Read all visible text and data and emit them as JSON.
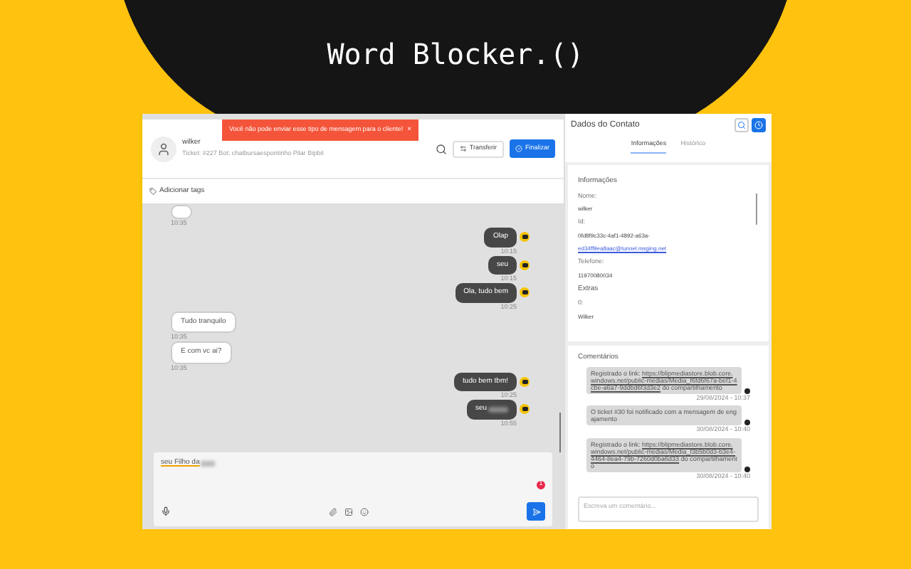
{
  "banner": {
    "title": "Word Blocker.()"
  },
  "toast": {
    "message": "Você não pode enviar esse tipo de mensagem para o cliente!",
    "close": "×"
  },
  "contact_header": {
    "name": "wilker",
    "subtitle": "Ticket: #227 Bot: chatbursaespontinho Pilar Bipbit",
    "transfer": "Transferir",
    "finish": "Finalizar"
  },
  "tags": {
    "label": "Adicionar tags"
  },
  "messages": [
    {
      "kind": "in",
      "time": "10:35",
      "blurred": false
    },
    {
      "kind": "out",
      "text": "Olap",
      "time": "10:15",
      "blurred": false
    },
    {
      "kind": "out",
      "text": "seu",
      "time": "10:15",
      "blurred": false
    },
    {
      "kind": "out",
      "text": "Ola, tudo bem",
      "time": "10:25",
      "blurred": false
    },
    {
      "kind": "in",
      "text": "Tudo tranquilo",
      "time": "10:35",
      "blurred": false
    },
    {
      "kind": "in",
      "text": "E com vc ai?",
      "time": "10:35",
      "blurred": false
    },
    {
      "kind": "out",
      "text": "tudo bem tbm!",
      "time": "10:25",
      "blurred": false
    },
    {
      "kind": "out",
      "text": "seu",
      "time": "10:55",
      "blurred": true
    }
  ],
  "composer": {
    "value": "seu Filho da",
    "blurred_tail": true,
    "badge": "1"
  },
  "contact_panel": {
    "title": "Dados do Contato",
    "tabs": [
      {
        "label": "Informações",
        "selected": true
      },
      {
        "label": "Histórico",
        "selected": false
      }
    ],
    "info": {
      "heading": "Informações",
      "fields": [
        {
          "kind": "label",
          "text": "Nome:"
        },
        {
          "kind": "value",
          "text": "wilker"
        },
        {
          "kind": "label",
          "text": "Id:"
        },
        {
          "kind": "value",
          "text": "0fd8f9c33c-4af1-4892-a63a-"
        },
        {
          "kind": "link",
          "text": "ed34ff9ea8aac@tunnel.msging.net"
        },
        {
          "kind": "label",
          "text": "Telefone:"
        },
        {
          "kind": "value",
          "text": "11970080034"
        },
        {
          "kind": "heading",
          "text": "Extras"
        },
        {
          "kind": "label",
          "text": "0:"
        },
        {
          "kind": "value",
          "text": "Wilker"
        }
      ]
    },
    "comments": {
      "heading": "Comentários",
      "placeholder": "Escreva um comentário...",
      "items": [
        {
          "parts": [
            {
              "kind": "text",
              "text": "Registrado o link: "
            },
            {
              "kind": "link",
              "text": "https://blipmediastore.blob.core.windows.net/public-medias/Media_f6fd6f67a-bef1-4cbe-a6a7-9ddbd6f3d3e2"
            },
            {
              "kind": "text",
              "text": " do compartilhamento"
            }
          ],
          "time": "29/08/2024 - 10:37"
        },
        {
          "parts": [
            {
              "kind": "text",
              "text": "O ticket #30 foi notificado com a mensagem de engajamento"
            }
          ],
          "time": "30/08/2024 - 10:40"
        },
        {
          "parts": [
            {
              "kind": "text",
              "text": "Registrado o link: "
            },
            {
              "kind": "link",
              "text": "https://blipmediastore.blob.core.windows.net/public-medias/Media_f3b5b0d3-b3e4-4464-8ea4-79b-7260d0ba6d33"
            },
            {
              "kind": "text",
              "text": " do compartilhamento"
            }
          ],
          "time": "30/08/2024 - 10:40"
        }
      ]
    }
  }
}
